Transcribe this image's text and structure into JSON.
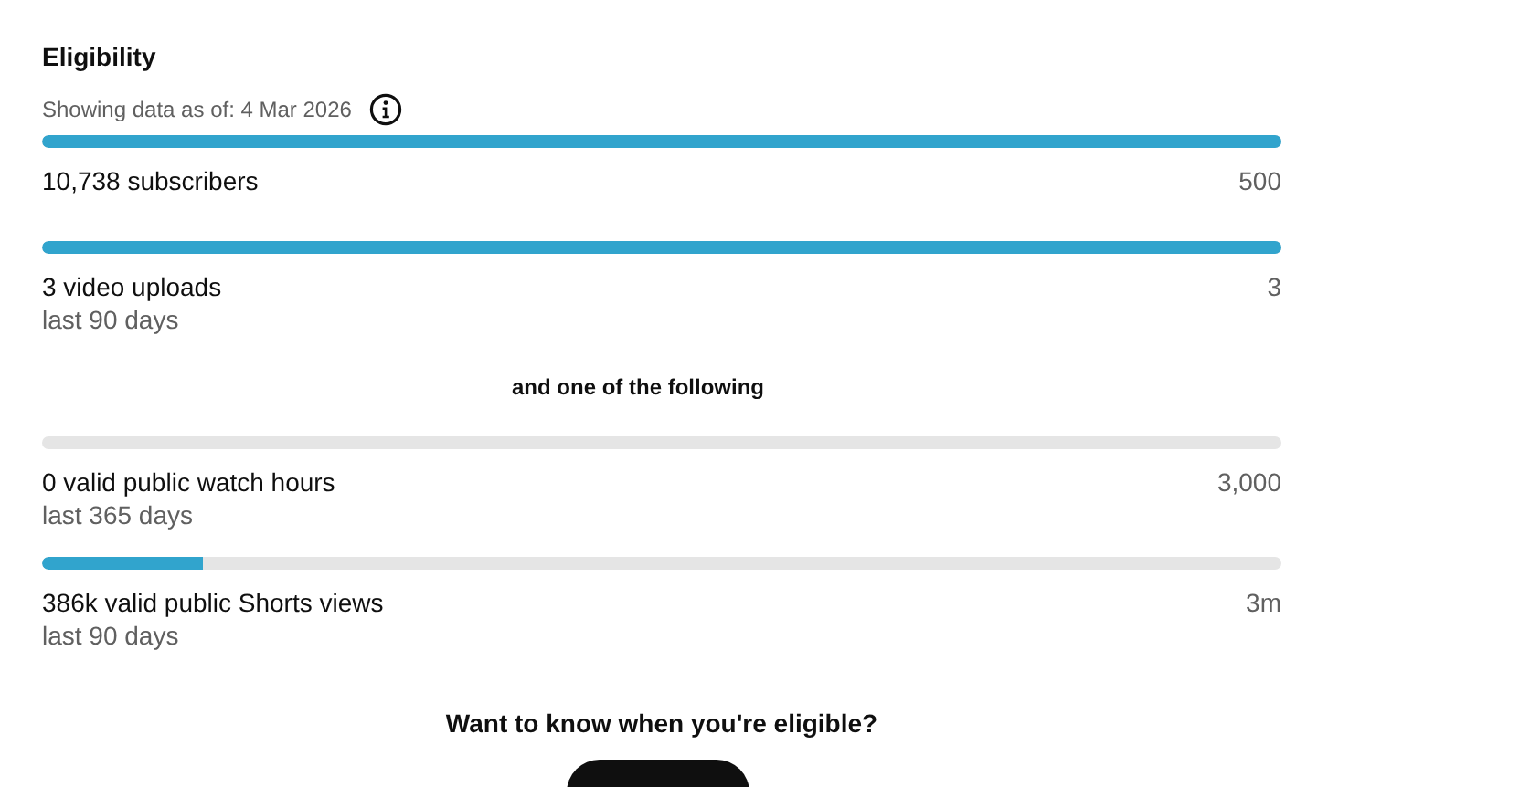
{
  "title": "Eligibility",
  "data_date": "Showing data as of: 4 Mar 2026",
  "required": [
    {
      "label": "10,738 subscribers",
      "target": "500",
      "level": 1
    },
    {
      "label": "3 video uploads",
      "period": "last 90 days",
      "target": "3",
      "level": 1
    }
  ],
  "separator": "and one of the following",
  "optional": [
    {
      "label": "0 valid public watch hours",
      "period": "last 365 days",
      "target": "3,000",
      "level": 0
    },
    {
      "label": "386k valid public Shorts views",
      "period": "last 90 days",
      "target": "3m",
      "level": 0.13
    }
  ],
  "notify_heading": "Want to know when you're eligible?"
}
